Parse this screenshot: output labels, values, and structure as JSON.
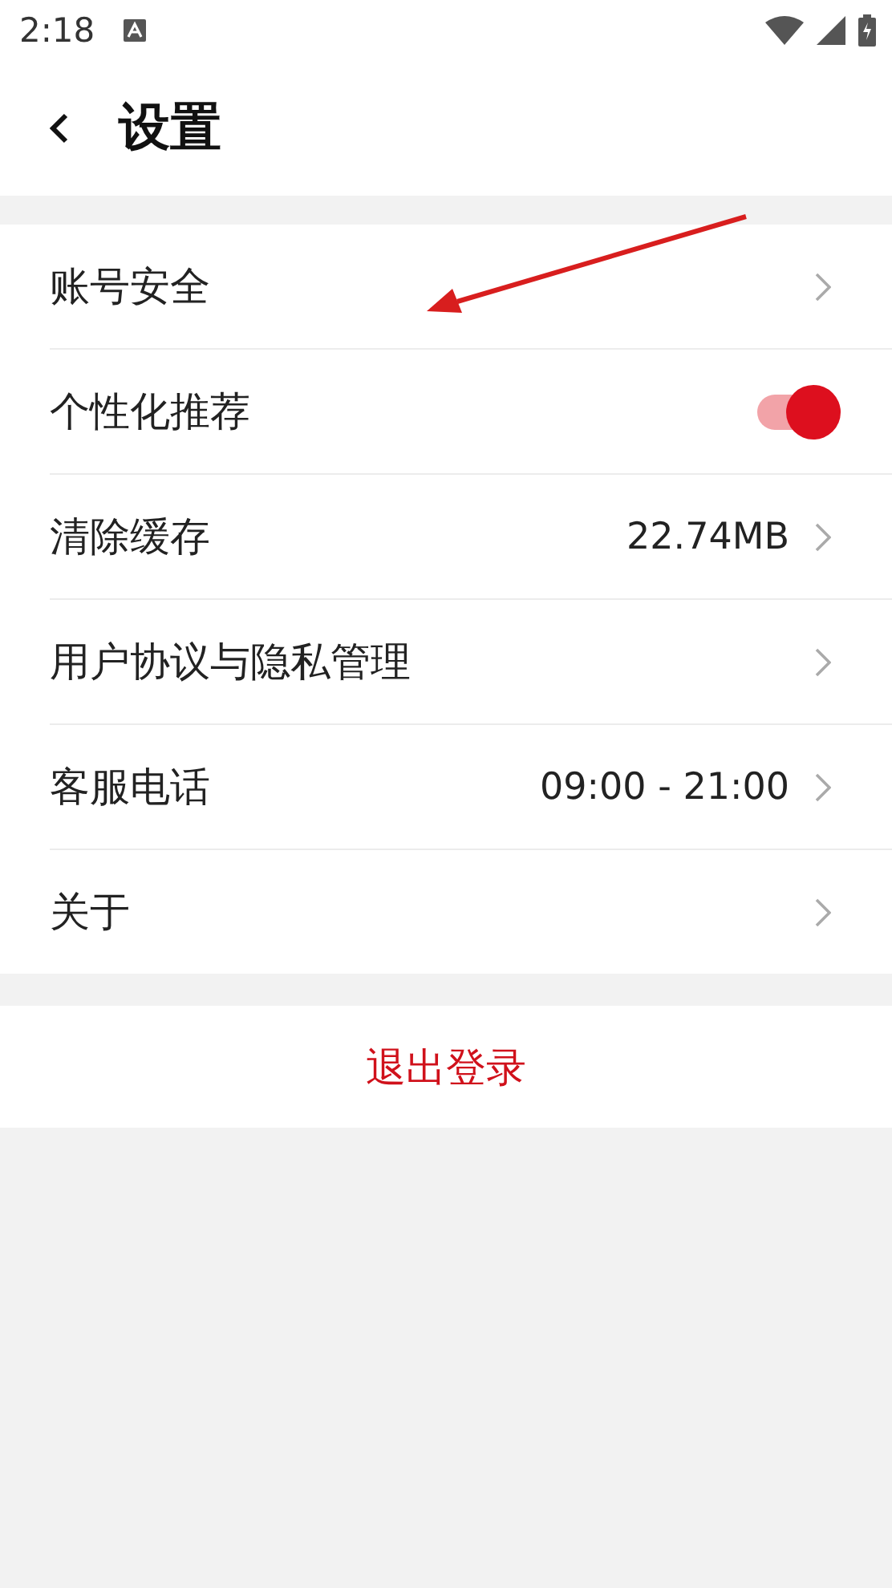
{
  "status_bar": {
    "time": "2:18"
  },
  "header": {
    "title": "设置"
  },
  "items": [
    {
      "label": "账号安全",
      "kind": "link"
    },
    {
      "label": "个性化推荐",
      "kind": "toggle",
      "on": true
    },
    {
      "label": "清除缓存",
      "kind": "link",
      "value": "22.74MB"
    },
    {
      "label": "用户协议与隐私管理",
      "kind": "link"
    },
    {
      "label": "客服电话",
      "kind": "link",
      "value": "09:00 - 21:00"
    },
    {
      "label": "关于",
      "kind": "link"
    }
  ],
  "logout": {
    "label": "退出登录"
  }
}
